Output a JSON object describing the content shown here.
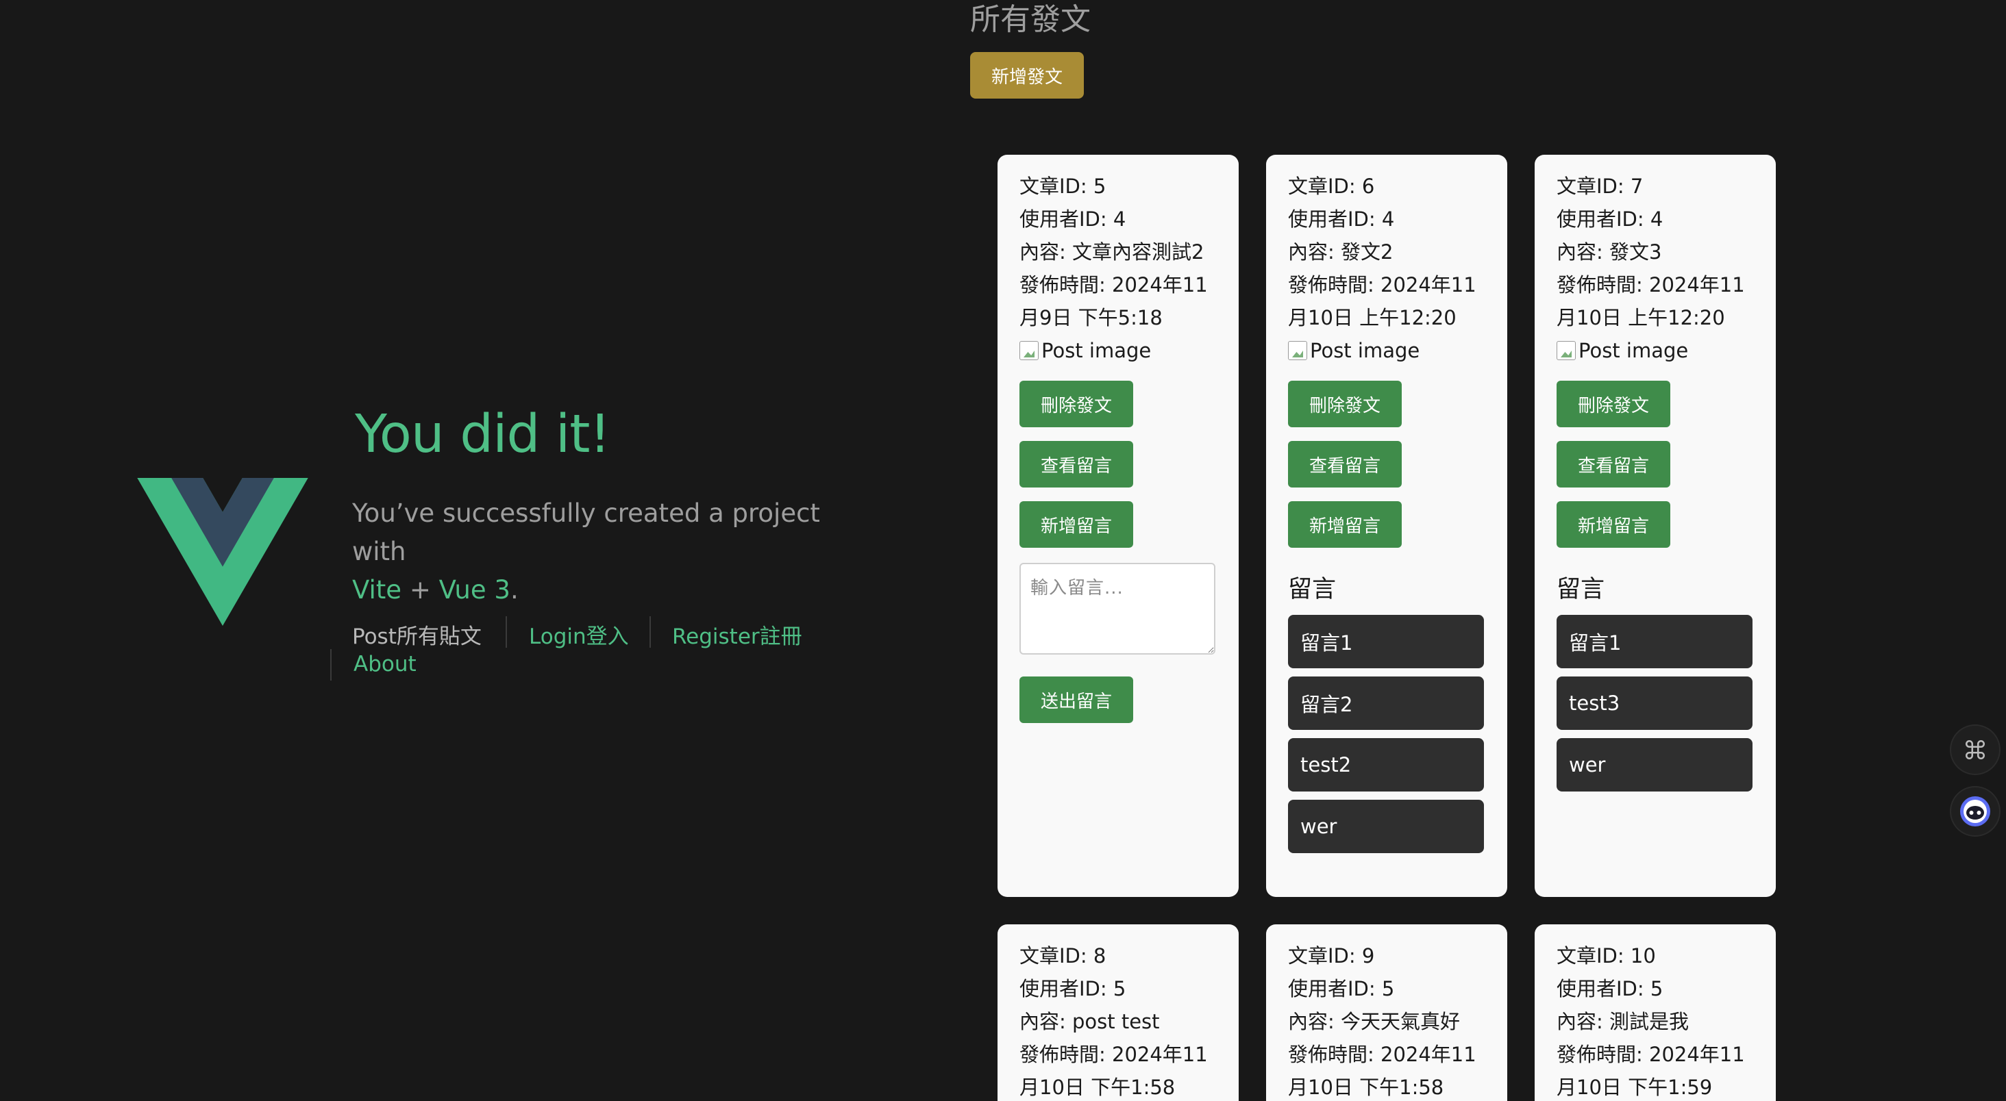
{
  "hero": {
    "title": "You did it!",
    "subtitle_prefix": "You’ve successfully created a project with",
    "vite": "Vite",
    "plus": "+",
    "vue": "Vue 3",
    "period": "."
  },
  "nav": {
    "posts": "Post所有貼文",
    "login": "Login登入",
    "register": "Register註冊",
    "about": "About"
  },
  "section_title": "所有發文",
  "new_post_label": "新增發文",
  "labels": {
    "delete": "刪除發文",
    "view": "查看留言",
    "add": "新增留言",
    "send": "送出留言",
    "comments_heading": "留言",
    "image_alt": "Post image",
    "comment_placeholder": "輸入留言..."
  },
  "posts": [
    {
      "article_id": "文章ID: 5",
      "user_id": "使用者ID: 4",
      "content": "內容: 文章內容測試2",
      "time": "發佈時間: 2024年11月9日 下午5:18"
    },
    {
      "article_id": "文章ID: 6",
      "user_id": "使用者ID: 4",
      "content": "內容: 發文2",
      "time": "發佈時間: 2024年11月10日 上午12:20",
      "comments": [
        "留言1",
        "留言2",
        "test2",
        "wer"
      ]
    },
    {
      "article_id": "文章ID: 7",
      "user_id": "使用者ID: 4",
      "content": "內容: 發文3",
      "time": "發佈時間: 2024年11月10日 上午12:20",
      "comments": [
        "留言1",
        "test3",
        "wer"
      ]
    },
    {
      "article_id": "文章ID: 8",
      "user_id": "使用者ID: 5",
      "content": "內容: post test",
      "time": "發佈時間: 2024年11月10日 下午1:58"
    },
    {
      "article_id": "文章ID: 9",
      "user_id": "使用者ID: 5",
      "content": "內容: 今天天氣真好",
      "time": "發佈時間: 2024年11月10日 下午1:58"
    },
    {
      "article_id": "文章ID: 10",
      "user_id": "使用者ID: 5",
      "content": "內容: 測試是我",
      "time": "發佈時間: 2024年11月10日 下午1:59"
    }
  ],
  "icons": {
    "vue_logo": "vue-logo",
    "shortcut": "command-icon",
    "assistant": "assistant-bot-icon"
  },
  "colors": {
    "background": "#181818",
    "vue_green": "#4fbf86",
    "vue_dark": "#35495e",
    "button_green": "#3f8c4a",
    "gold": "#a98c35",
    "card": "#f9f9f9",
    "comment_bg": "#2f2f2f"
  }
}
